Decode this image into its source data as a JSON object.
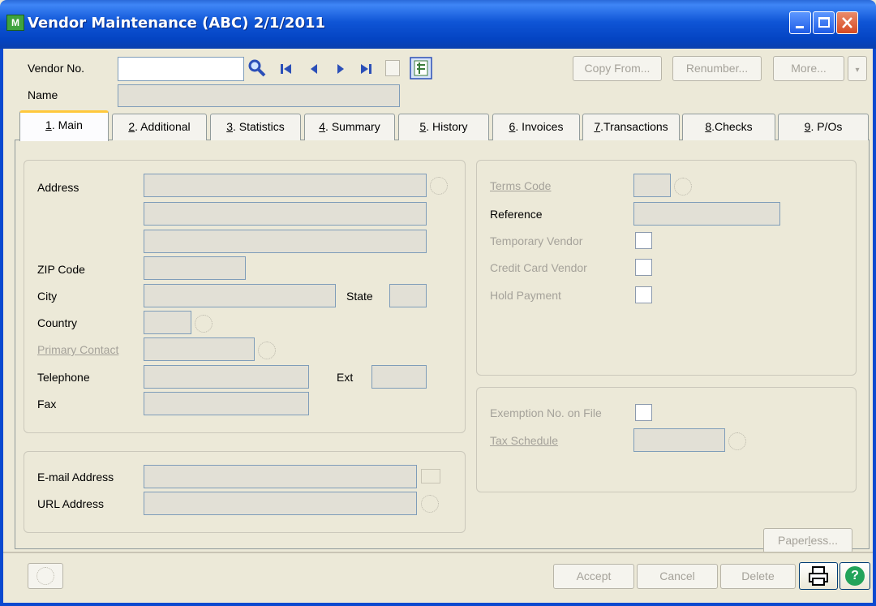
{
  "window": {
    "title": "Vendor Maintenance (ABC) 2/1/2011",
    "app_icon_text": "M"
  },
  "header": {
    "vendor_no_label": "Vendor No.",
    "name_label": "Name",
    "vendor_no_value": "",
    "name_value": "",
    "copy_from_label": "Copy From...",
    "renumber_label": "Renumber...",
    "more_label": "More..."
  },
  "tabs": [
    {
      "num": "1",
      "text": ". Main"
    },
    {
      "num": "2",
      "text": ". Additional"
    },
    {
      "num": "3",
      "text": ". Statistics"
    },
    {
      "num": "4",
      "text": ". Summary"
    },
    {
      "num": "5",
      "text": ". History"
    },
    {
      "num": "6",
      "text": ". Invoices"
    },
    {
      "num": "7",
      "text": ".Transactions"
    },
    {
      "num": "8",
      "text": ".Checks"
    },
    {
      "num": "9",
      "text": ". P/Os"
    }
  ],
  "main": {
    "address_label": "Address",
    "zip_label": "ZIP Code",
    "city_label": "City",
    "state_label": "State",
    "country_label": "Country",
    "primary_contact_label": "Primary Contact",
    "telephone_label": "Telephone",
    "ext_label": "Ext",
    "fax_label": "Fax",
    "email_label": "E-mail Address",
    "url_label": "URL Address",
    "terms_code_label": "Terms Code",
    "reference_label": "Reference",
    "temporary_vendor_label": "Temporary Vendor",
    "credit_card_vendor_label": "Credit Card Vendor",
    "hold_payment_label": "Hold Payment",
    "exemption_label": "Exemption No. on File",
    "tax_schedule_label": "Tax Schedule",
    "paperless_pre": "Paper",
    "paperless_ul": "l",
    "paperless_post": "ess..."
  },
  "footer": {
    "accept_label": "Accept",
    "cancel_label": "Cancel",
    "delete_label": "Delete"
  },
  "colors": {
    "titlebar": "#0a49d0",
    "tab_accent": "#ffc83c",
    "help": "#22a35a"
  }
}
